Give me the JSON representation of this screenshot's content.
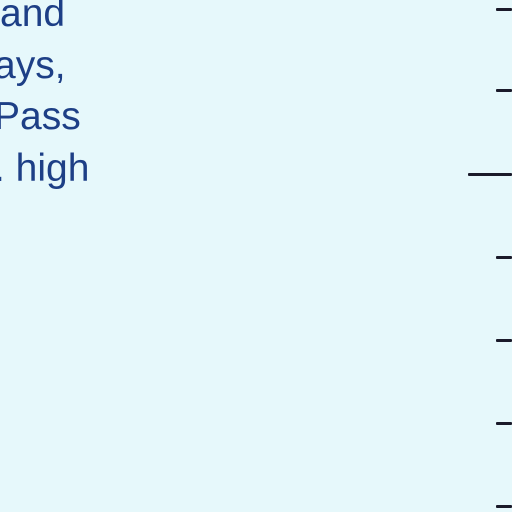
{
  "text_block": {
    "lines": [
      "and",
      "ays,",
      "Pass",
      ". high"
    ]
  },
  "colors": {
    "background": "#e6f8fb",
    "text": "#1d3f86",
    "tick": "#1a1a2a"
  }
}
